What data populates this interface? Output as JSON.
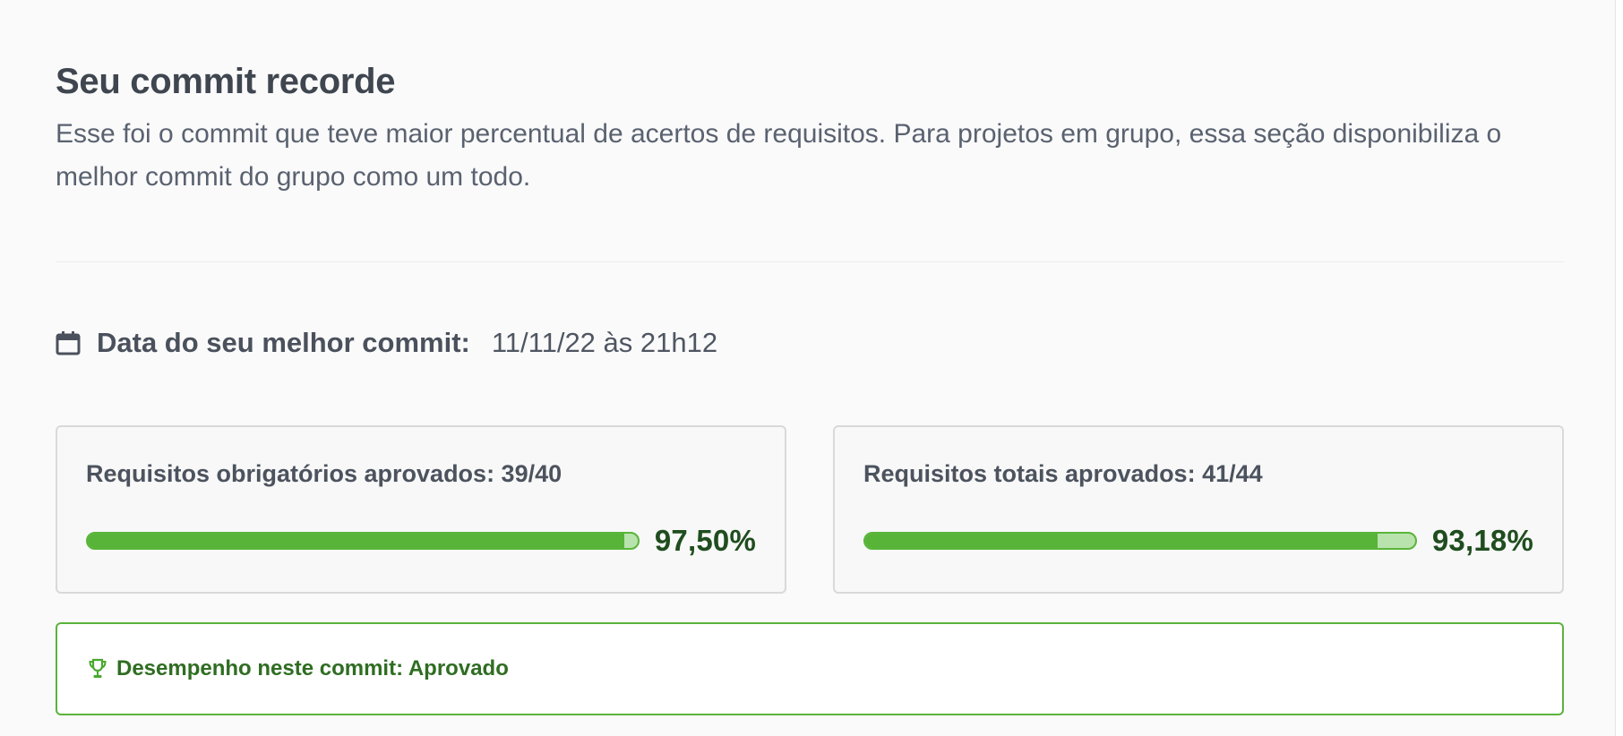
{
  "section": {
    "title": "Seu commit recorde",
    "description": "Esse foi o commit que teve maior percentual de acertos de requisitos. Para projetos em grupo, essa seção disponibiliza o melhor commit do grupo como um todo."
  },
  "best_commit": {
    "date_label": "Data do seu melhor commit:",
    "date_value": "11/11/22 às 21h12",
    "icon": "calendar-icon"
  },
  "cards": [
    {
      "label": "Requisitos obrigatórios aprovados: 39/40",
      "percent_text": "97,50%",
      "progress": 0.975
    },
    {
      "label": "Requisitos totais aprovados: 41/44",
      "percent_text": "93,18%",
      "progress": 0.9318
    }
  ],
  "status": {
    "text": "Desempenho neste commit: Aprovado",
    "icon": "trophy-icon"
  },
  "colors": {
    "accent_green": "#58b339",
    "track_green": "#b9e3ad",
    "dark_green_text": "#1f4d1f",
    "status_text": "#2f6d22",
    "border_green": "#5cb33c"
  }
}
